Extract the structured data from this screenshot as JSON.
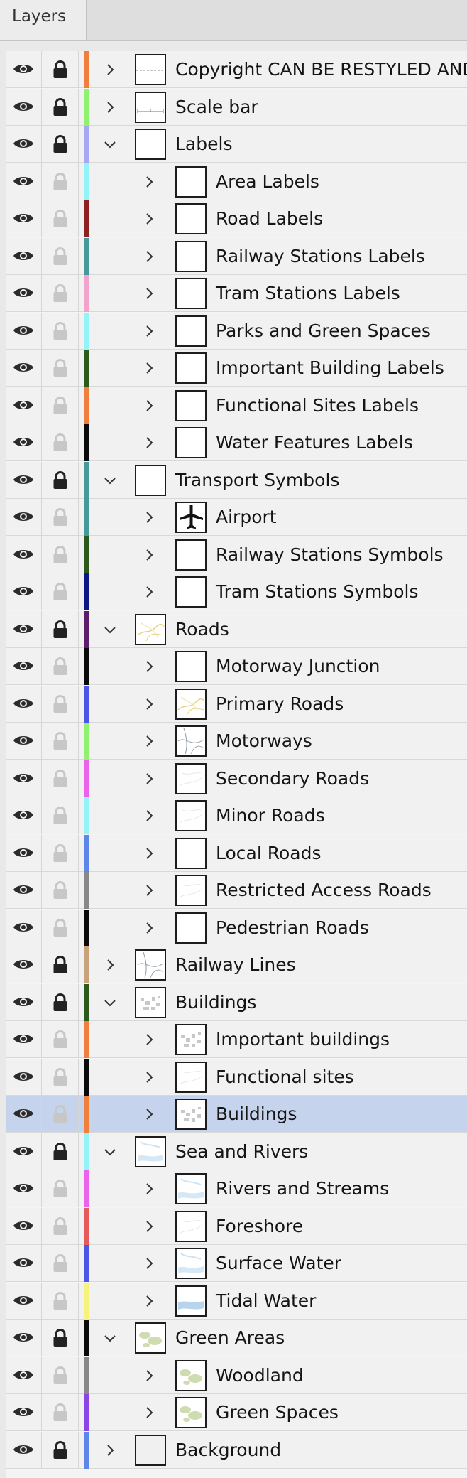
{
  "panel": {
    "tab_label": "Layers"
  },
  "layers": [
    {
      "name": "Copyright CAN BE RESTYLED AND",
      "level": 0,
      "expanded": false,
      "color": "#f07e3c",
      "locked": true,
      "thumb": "line"
    },
    {
      "name": "Scale bar",
      "level": 0,
      "expanded": false,
      "color": "#8ff26c",
      "locked": true,
      "thumb": "scale"
    },
    {
      "name": "Labels",
      "level": 0,
      "expanded": true,
      "color": "#a8a8f2",
      "locked": true,
      "thumb": "blank"
    },
    {
      "name": "Area Labels",
      "level": 1,
      "expanded": false,
      "color": "#93f4f8",
      "locked": false,
      "thumb": "blank"
    },
    {
      "name": "Road Labels",
      "level": 1,
      "expanded": false,
      "color": "#8e2120",
      "locked": false,
      "thumb": "blank"
    },
    {
      "name": "Railway Stations Labels",
      "level": 1,
      "expanded": false,
      "color": "#46999a",
      "locked": false,
      "thumb": "blank"
    },
    {
      "name": "Tram Stations Labels",
      "level": 1,
      "expanded": false,
      "color": "#f2a3cc",
      "locked": false,
      "thumb": "blank"
    },
    {
      "name": "Parks and Green Spaces",
      "level": 1,
      "expanded": false,
      "color": "#93f4f8",
      "locked": false,
      "thumb": "blank"
    },
    {
      "name": "Important Building Labels",
      "level": 1,
      "expanded": false,
      "color": "#2c5a1d",
      "locked": false,
      "thumb": "blank"
    },
    {
      "name": "Functional Sites Labels",
      "level": 1,
      "expanded": false,
      "color": "#f07e3c",
      "locked": false,
      "thumb": "blank"
    },
    {
      "name": "Water Features Labels",
      "level": 1,
      "expanded": false,
      "color": "#0a0a0a",
      "locked": false,
      "thumb": "blank"
    },
    {
      "name": "Transport Symbols",
      "level": 0,
      "expanded": true,
      "color": "#46999a",
      "locked": true,
      "thumb": "blank"
    },
    {
      "name": "Airport",
      "level": 1,
      "expanded": false,
      "color": "#46999a",
      "locked": false,
      "thumb": "plane"
    },
    {
      "name": "Railway Stations Symbols",
      "level": 1,
      "expanded": false,
      "color": "#2c5a1d",
      "locked": false,
      "thumb": "blank"
    },
    {
      "name": "Tram Stations Symbols",
      "level": 1,
      "expanded": false,
      "color": "#0e1785",
      "locked": false,
      "thumb": "blank"
    },
    {
      "name": "Roads",
      "level": 0,
      "expanded": true,
      "color": "#5b1e6b",
      "locked": true,
      "thumb": "roads"
    },
    {
      "name": "Motorway Junction",
      "level": 1,
      "expanded": false,
      "color": "#0a0a0a",
      "locked": false,
      "thumb": "blank"
    },
    {
      "name": "Primary Roads",
      "level": 1,
      "expanded": false,
      "color": "#4c55e6",
      "locked": false,
      "thumb": "roads"
    },
    {
      "name": "Motorways",
      "level": 1,
      "expanded": false,
      "color": "#8ff26c",
      "locked": false,
      "thumb": "lines"
    },
    {
      "name": "Secondary Roads",
      "level": 1,
      "expanded": false,
      "color": "#ea63ea",
      "locked": false,
      "thumb": "faint"
    },
    {
      "name": "Minor Roads",
      "level": 1,
      "expanded": false,
      "color": "#93f4f8",
      "locked": false,
      "thumb": "faint"
    },
    {
      "name": "Local Roads",
      "level": 1,
      "expanded": false,
      "color": "#5c86ea",
      "locked": false,
      "thumb": "blank"
    },
    {
      "name": "Restricted Access Roads",
      "level": 1,
      "expanded": false,
      "color": "#888888",
      "locked": false,
      "thumb": "faint"
    },
    {
      "name": "Pedestrian Roads",
      "level": 1,
      "expanded": false,
      "color": "#0a0a0a",
      "locked": false,
      "thumb": "blank"
    },
    {
      "name": "Railway Lines",
      "level": 0,
      "expanded": false,
      "color": "#c8a27a",
      "locked": true,
      "thumb": "lines"
    },
    {
      "name": "Buildings",
      "level": 0,
      "expanded": true,
      "color": "#2c5a1d",
      "locked": true,
      "thumb": "buildings"
    },
    {
      "name": "Important buildings",
      "level": 1,
      "expanded": false,
      "color": "#f07e3c",
      "locked": false,
      "thumb": "buildings"
    },
    {
      "name": "Functional sites",
      "level": 1,
      "expanded": false,
      "color": "#0a0a0a",
      "locked": false,
      "thumb": "faint"
    },
    {
      "name": "Buildings",
      "level": 1,
      "expanded": false,
      "color": "#f07e3c",
      "locked": false,
      "thumb": "buildings",
      "selected": true
    },
    {
      "name": "Sea and Rivers",
      "level": 0,
      "expanded": true,
      "color": "#93f4f8",
      "locked": true,
      "thumb": "water"
    },
    {
      "name": "Rivers and Streams",
      "level": 1,
      "expanded": false,
      "color": "#ea63ea",
      "locked": false,
      "thumb": "water"
    },
    {
      "name": "Foreshore",
      "level": 1,
      "expanded": false,
      "color": "#e55a5a",
      "locked": false,
      "thumb": "faint"
    },
    {
      "name": "Surface Water",
      "level": 1,
      "expanded": false,
      "color": "#4c55e6",
      "locked": false,
      "thumb": "water"
    },
    {
      "name": "Tidal Water",
      "level": 1,
      "expanded": false,
      "color": "#f7f27a",
      "locked": false,
      "thumb": "tidal"
    },
    {
      "name": "Green Areas",
      "level": 0,
      "expanded": true,
      "color": "#0a0a0a",
      "locked": true,
      "thumb": "green"
    },
    {
      "name": "Woodland",
      "level": 1,
      "expanded": false,
      "color": "#888888",
      "locked": false,
      "thumb": "green"
    },
    {
      "name": "Green Spaces",
      "level": 1,
      "expanded": false,
      "color": "#8b45e6",
      "locked": false,
      "thumb": "green"
    },
    {
      "name": "Background",
      "level": 0,
      "expanded": false,
      "color": "#5c86ea",
      "locked": true,
      "thumb": "background"
    }
  ]
}
